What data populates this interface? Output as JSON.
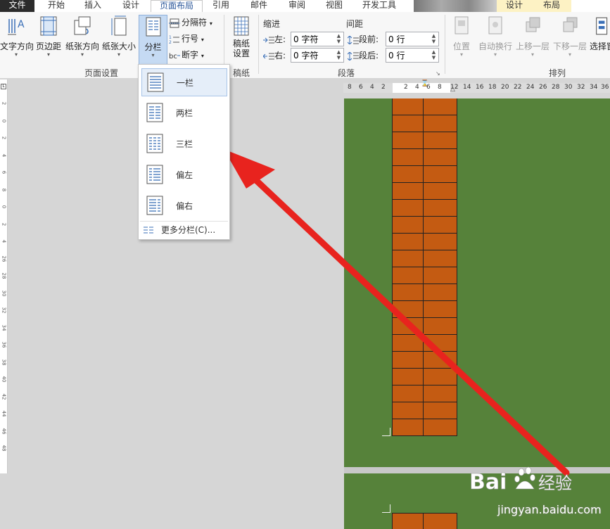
{
  "tabs": {
    "file": "文件",
    "home": "开始",
    "insert": "插入",
    "design": "设计",
    "page_layout": "页面布局",
    "references": "引用",
    "mailings": "邮件",
    "review": "审阅",
    "view": "视图",
    "developer": "开发工具",
    "ctx_design": "设计",
    "ctx_layout": "布局"
  },
  "ribbon": {
    "text_direction": "文字方向",
    "margins": "页边距",
    "orientation": "纸张方向",
    "size": "纸张大小",
    "columns": "分栏",
    "breaks": "分隔符",
    "line_numbers": "行号",
    "hyphenation": "断字",
    "page_setup_group": "页面设置",
    "manuscript_line1": "稿纸",
    "manuscript_line2": "设置",
    "manuscript_group": "稿纸",
    "indent_title": "缩进",
    "spacing_title": "间距",
    "indent_left_label": "左:",
    "indent_left_value": "0 字符",
    "indent_right_label": "右:",
    "indent_right_value": "0 字符",
    "spacing_before_label": "段前:",
    "spacing_before_value": "0 行",
    "spacing_after_label": "段后:",
    "spacing_after_value": "0 行",
    "paragraph_group": "段落",
    "position": "位置",
    "wrap_text": "自动换行",
    "bring_forward": "上移一层",
    "send_backward": "下移一层",
    "selection_pane": "选择窗",
    "arrange_group": "排列"
  },
  "ruler_numbers": [
    "8",
    "6",
    "4",
    "2",
    "2",
    "4",
    "6",
    "8",
    "12",
    "14",
    "16",
    "18",
    "20",
    "22",
    "24",
    "26",
    "28",
    "30",
    "32",
    "34",
    "36"
  ],
  "vruler_numbers": [
    "2",
    "0",
    "2",
    "4",
    "6",
    "8",
    "0",
    "2",
    "4",
    "26",
    "28",
    "30",
    "32",
    "34",
    "36",
    "38",
    "40",
    "42",
    "44",
    "46",
    "48"
  ],
  "columns_menu": {
    "items": [
      {
        "label": "一栏",
        "icon": "one-column-icon",
        "selected": true
      },
      {
        "label": "两栏",
        "icon": "two-columns-icon",
        "selected": false
      },
      {
        "label": "三栏",
        "icon": "three-columns-icon",
        "selected": false
      },
      {
        "label": "偏左",
        "icon": "left-column-icon",
        "selected": false
      },
      {
        "label": "偏右",
        "icon": "right-column-icon",
        "selected": false
      }
    ],
    "more": "更多分栏(C)..."
  },
  "watermark": {
    "logo": "Bai 经验",
    "url": "jingyan.baidu.com"
  },
  "colors": {
    "page_green": "#56823a",
    "brick_orange": "#c45b12",
    "arrow_red": "#e8231e",
    "accent_blue": "#2b579a"
  }
}
